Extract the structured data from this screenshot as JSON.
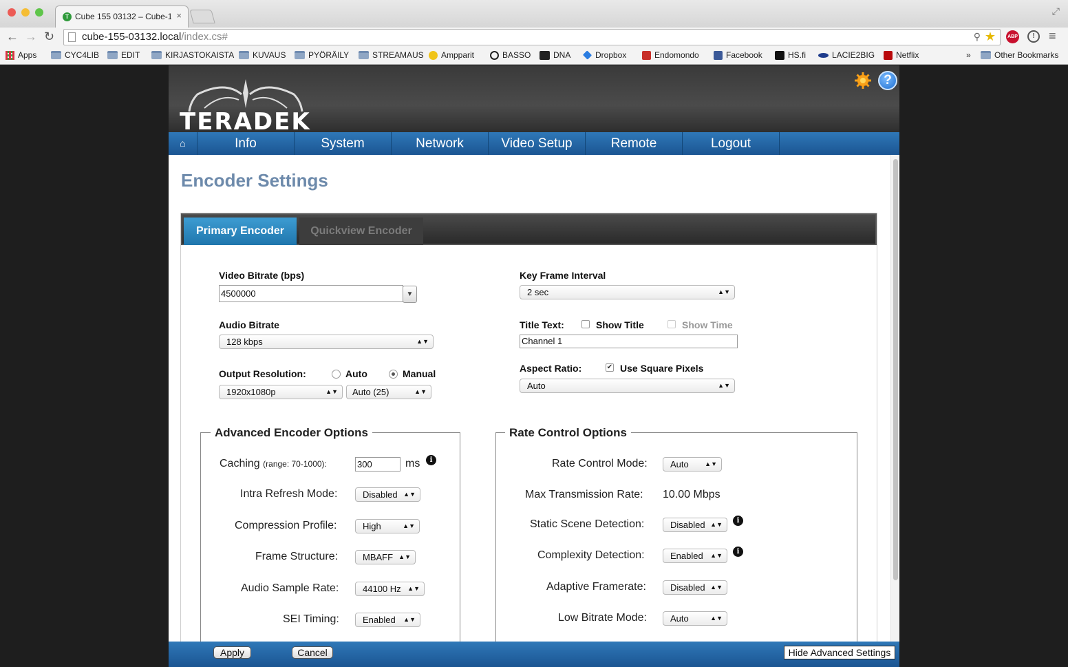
{
  "browser": {
    "tab_title": "Cube 155 03132 – Cube-1",
    "tab_close": "×",
    "url_host": "cube-155-03132.local",
    "url_path": "/index.cs#",
    "bookmarks": [
      {
        "label": "Apps",
        "icon": "apps-icon"
      },
      {
        "label": "CYC4LIB",
        "icon": "folder-icon"
      },
      {
        "label": "EDIT",
        "icon": "folder-icon"
      },
      {
        "label": "KIRJASTOKAISTA",
        "icon": "folder-icon"
      },
      {
        "label": "KUVAUS",
        "icon": "folder-icon"
      },
      {
        "label": "PYÖRÄILY",
        "icon": "folder-icon"
      },
      {
        "label": "STREAMAUS",
        "icon": "folder-icon"
      },
      {
        "label": "Ampparit",
        "icon": "ampparit-icon"
      },
      {
        "label": "BASSO",
        "icon": "basso-icon"
      },
      {
        "label": "DNA",
        "icon": "dna-icon"
      },
      {
        "label": "Dropbox",
        "icon": "dropbox-icon"
      },
      {
        "label": "Endomondo",
        "icon": "endomondo-icon"
      },
      {
        "label": "Facebook",
        "icon": "facebook-icon"
      },
      {
        "label": "HS.fi",
        "icon": "hs-icon"
      },
      {
        "label": "LACIE2BIG",
        "icon": "lacie-icon"
      },
      {
        "label": "Netflix",
        "icon": "netflix-icon"
      }
    ],
    "overflow": "»",
    "other_bookmarks": "Other Bookmarks"
  },
  "app": {
    "logo": "TERADEK",
    "nav": [
      "Info",
      "System",
      "Network",
      "Video Setup",
      "Remote",
      "Logout"
    ],
    "page_title": "Encoder Settings",
    "tabs": {
      "primary": "Primary Encoder",
      "quickview": "Quickview Encoder"
    }
  },
  "form": {
    "video_bitrate_label": "Video Bitrate (bps)",
    "video_bitrate_value": "4500000",
    "audio_bitrate_label": "Audio Bitrate",
    "audio_bitrate_value": "128 kbps",
    "output_res_label": "Output Resolution:",
    "output_res_auto": "Auto",
    "output_res_manual": "Manual",
    "output_res_mode": "Manual",
    "resolution_value": "1920x1080p",
    "framerate_value": "Auto (25)",
    "key_frame_label": "Key Frame Interval",
    "key_frame_value": "2 sec",
    "title_text_label": "Title Text:",
    "show_title_label": "Show Title",
    "show_time_label": "Show Time",
    "title_text_value": "Channel 1",
    "aspect_label": "Aspect Ratio:",
    "square_pixels_label": "Use Square Pixels",
    "aspect_value": "Auto"
  },
  "advanced": {
    "legend": "Advanced Encoder Options",
    "caching_label": "Caching",
    "caching_range": "(range: 70-1000):",
    "caching_value": "300",
    "caching_unit": "ms",
    "intra_label": "Intra Refresh Mode:",
    "intra_value": "Disabled",
    "profile_label": "Compression Profile:",
    "profile_value": "High",
    "frame_label": "Frame Structure:",
    "frame_value": "MBAFF",
    "sample_label": "Audio Sample Rate:",
    "sample_value": "44100 Hz",
    "sei_label": "SEI Timing:",
    "sei_value": "Enabled"
  },
  "rate": {
    "legend": "Rate Control Options",
    "mode_label": "Rate Control Mode:",
    "mode_value": "Auto",
    "max_label": "Max Transmission Rate:",
    "max_value": "10.00 Mbps",
    "static_label": "Static Scene Detection:",
    "static_value": "Disabled",
    "complexity_label": "Complexity Detection:",
    "complexity_value": "Enabled",
    "adaptive_label": "Adaptive Framerate:",
    "adaptive_value": "Disabled",
    "lowbit_label": "Low Bitrate Mode:",
    "lowbit_value": "Auto"
  },
  "footer": {
    "apply": "Apply",
    "cancel": "Cancel",
    "hide_advanced": "Hide Advanced Settings"
  },
  "colors": {
    "accent": "#1f76ad",
    "nav": "#2f78b8",
    "title": "#6d8aab"
  }
}
